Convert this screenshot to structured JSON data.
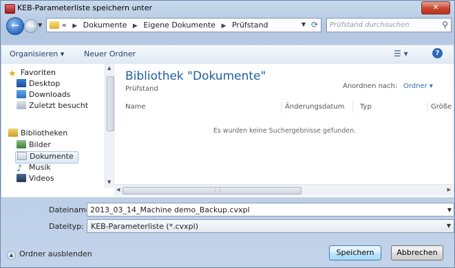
{
  "window": {
    "title": "KEB-Parameterliste speichern unter",
    "close_glyph": "✕"
  },
  "address": {
    "overflow": "«",
    "crumbs": [
      "Dokumente",
      "Eigene Dokumente",
      "Prüfstand"
    ]
  },
  "search": {
    "placeholder": "Prüfstand durchsuchen"
  },
  "toolbar": {
    "organize": "Organisieren ▾",
    "new_folder": "Neuer Ordner",
    "views": "☰ ▾",
    "help": "?"
  },
  "nav": {
    "favorites": "Favoriten",
    "desktop": "Desktop",
    "downloads": "Downloads",
    "recent": "Zuletzt besucht",
    "libraries": "Bibliotheken",
    "pictures": "Bilder",
    "documents": "Dokumente",
    "music": "Musik",
    "videos": "Videos"
  },
  "main": {
    "library_title": "Bibliothek \"Dokumente\"",
    "library_subtitle": "Prüfstand",
    "arrange_label": "Anordnen nach:",
    "arrange_value": "Ordner ▾",
    "columns": [
      "Name",
      "Änderungsdatum",
      "Typ",
      "Größe"
    ],
    "empty_message": "Es wurden keine Suchergebnisse gefunden."
  },
  "fields": {
    "filename_label": "Dateiname:",
    "filename_value": "2013_03_14_Machine demo_Backup.cvxpl",
    "filetype_label": "Dateityp:",
    "filetype_value": "KEB-Parameterliste (*.cvxpl)"
  },
  "footer": {
    "hide_folders": "Ordner ausblenden",
    "save": "Speichern",
    "cancel": "Abbrechen"
  },
  "colors": {
    "accent": "#1e5da1",
    "close_button": "#c9442f"
  }
}
